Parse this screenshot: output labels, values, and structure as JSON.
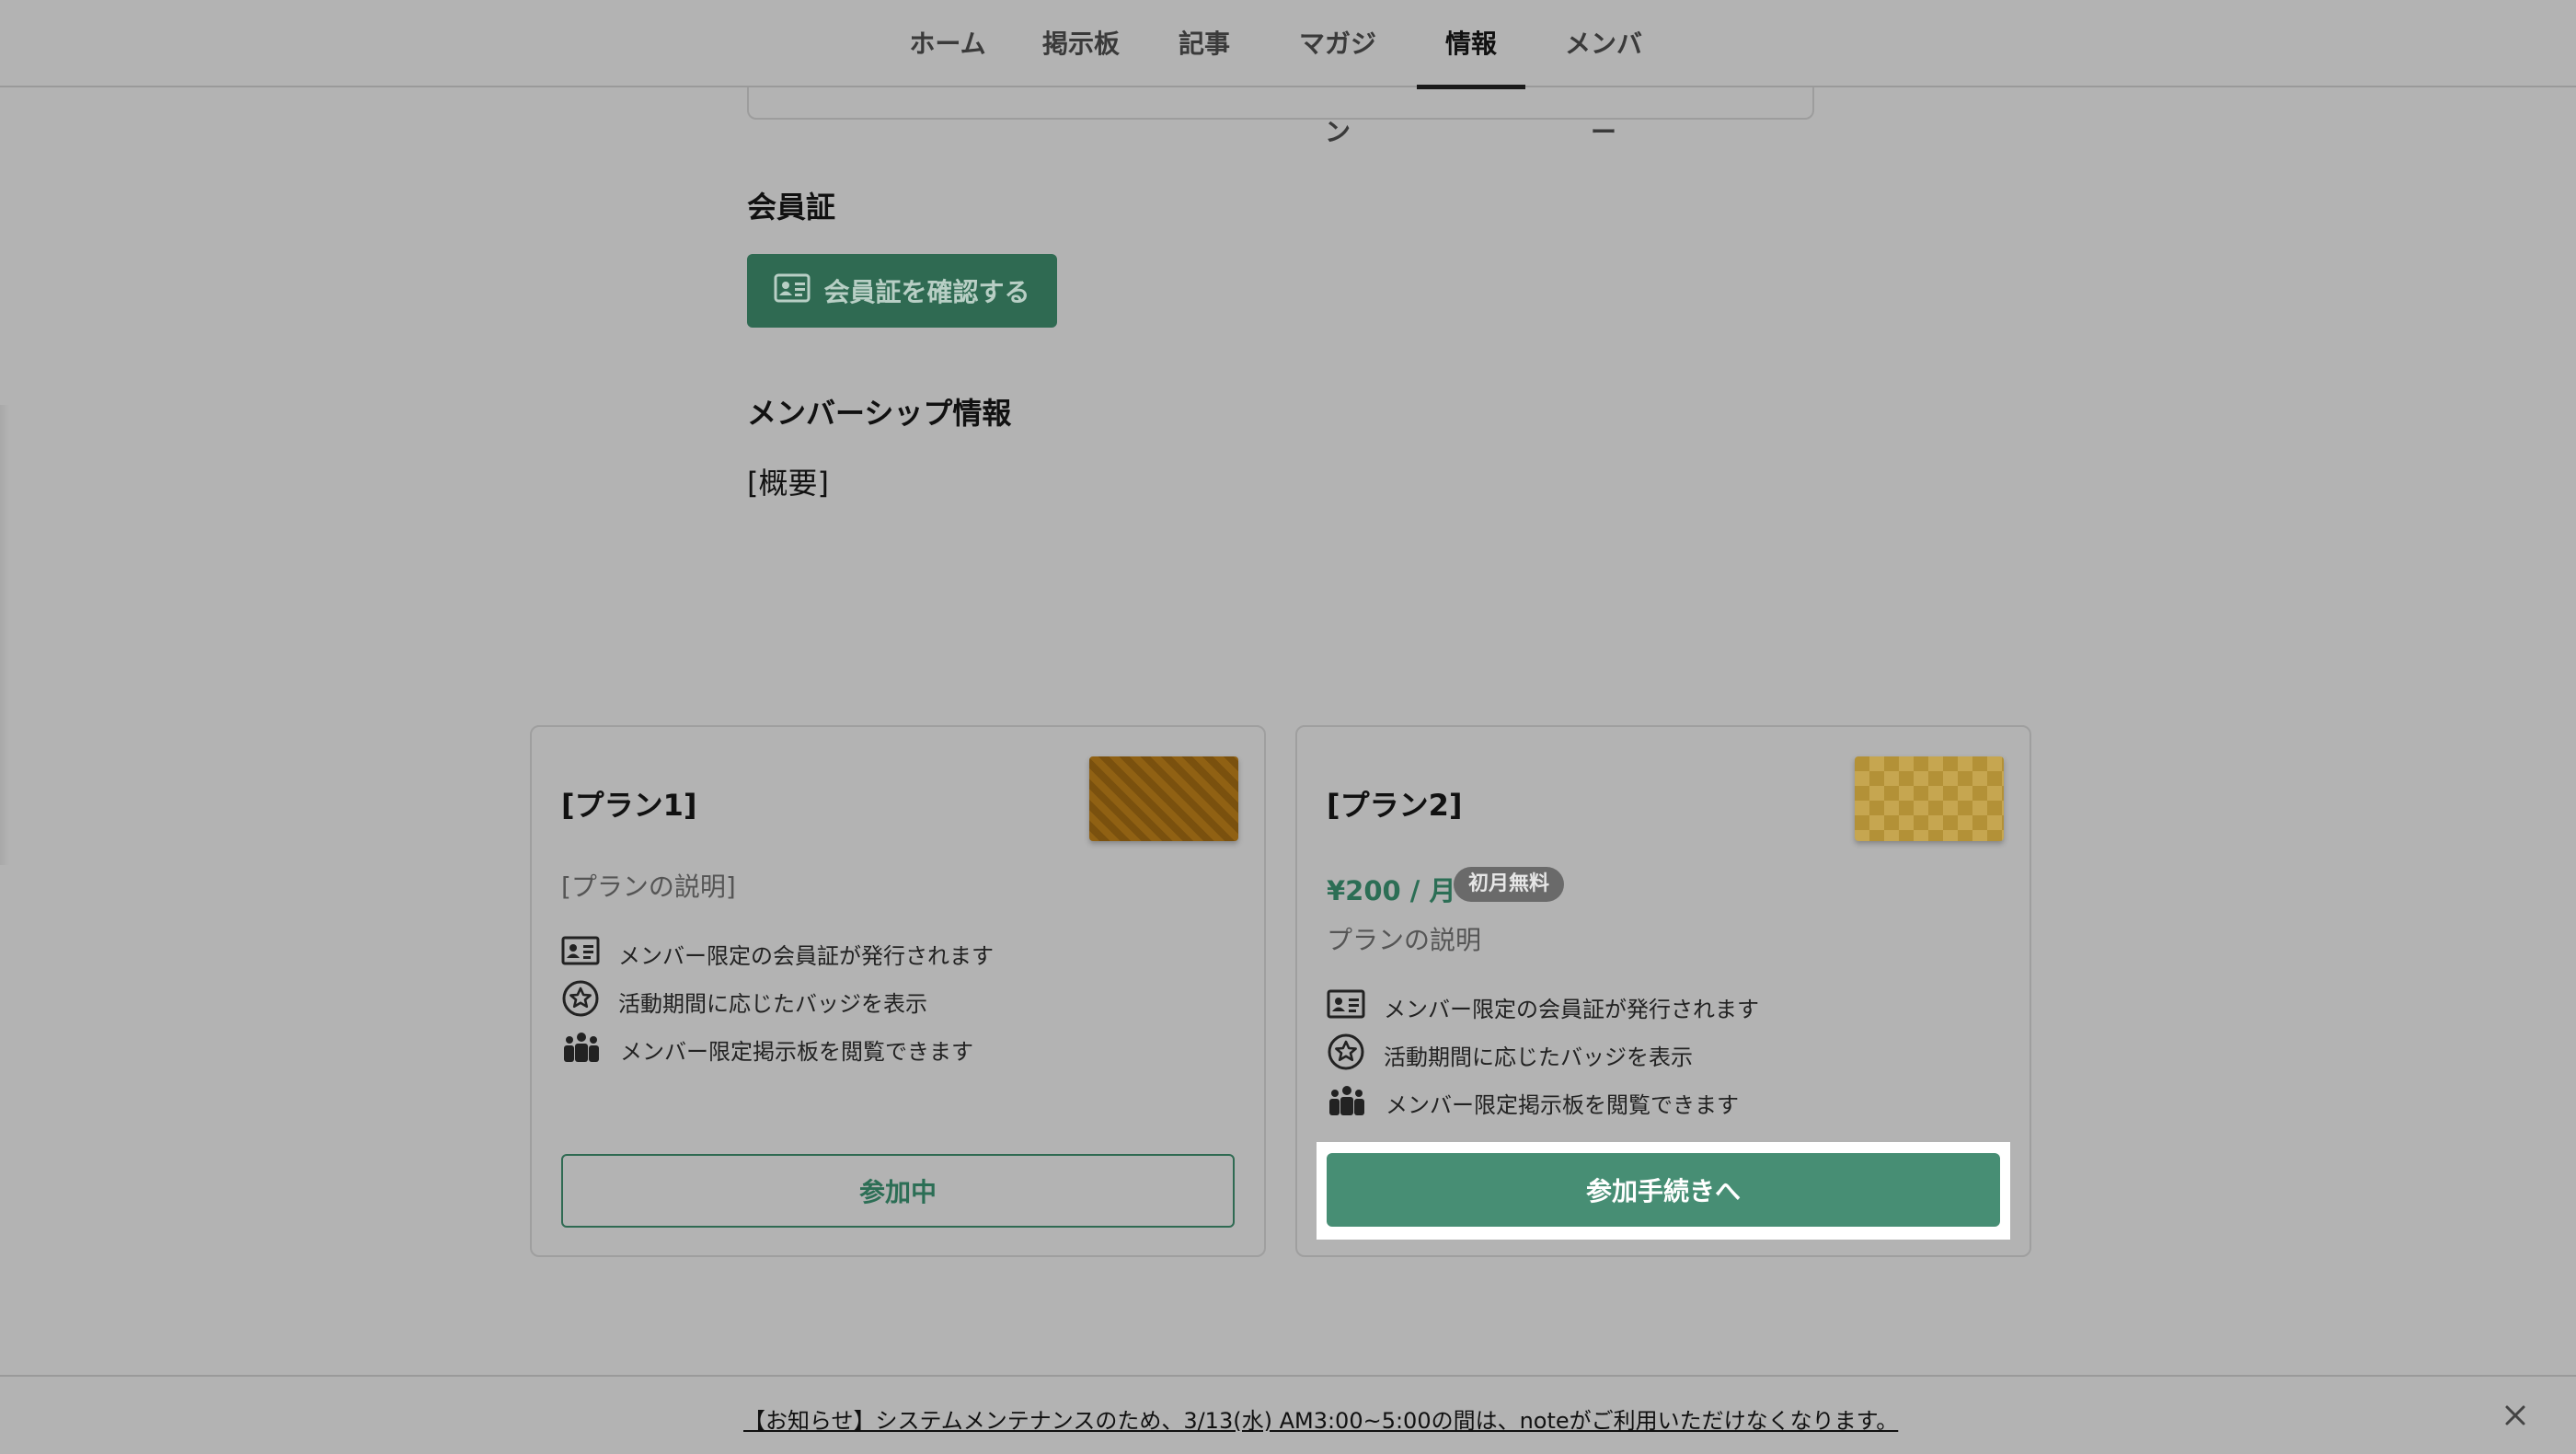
{
  "nav": {
    "tabs": [
      {
        "label": "ホーム",
        "active": false
      },
      {
        "label": "掲示板",
        "active": false
      },
      {
        "label": "記事",
        "active": false
      },
      {
        "label": "マガジン",
        "active": false
      },
      {
        "label": "情報",
        "active": true
      },
      {
        "label": "メンバー",
        "active": false
      }
    ]
  },
  "membership_card": {
    "heading": "会員証",
    "button_label": "会員証を確認する",
    "button_icon": "id-card-icon"
  },
  "membership_info": {
    "heading": "メンバーシップ情報",
    "overview": "[概要]"
  },
  "plans": [
    {
      "title": "[プラン1]",
      "description": "[プランの説明]",
      "features": [
        {
          "icon": "id-card-icon",
          "text": "メンバー限定の会員証が発行されます"
        },
        {
          "icon": "badge-star-icon",
          "text": "活動期間に応じたバッジを表示"
        },
        {
          "icon": "group-icon",
          "text": "メンバー限定掲示板を閲覧できます"
        }
      ],
      "button_label": "参加中"
    },
    {
      "title": "[プラン2]",
      "price": "¥200 / 月",
      "price_badge": "初月無料",
      "description": "プランの説明",
      "features": [
        {
          "icon": "id-card-icon",
          "text": "メンバー限定の会員証が発行されます"
        },
        {
          "icon": "badge-star-icon",
          "text": "活動期間に応じたバッジを表示"
        },
        {
          "icon": "group-icon",
          "text": "メンバー限定掲示板を閲覧できます"
        }
      ],
      "button_label": "参加手続きへ"
    }
  ],
  "notice": {
    "text": "【お知らせ】システムメンテナンスのため、3/13(水) AM3:00~5:00の間は、noteがご利用いただけなくなります。",
    "close_icon": "close-icon"
  },
  "colors": {
    "accent": "#2f6a52",
    "accent_light": "#478e74",
    "overlay_bg": "#b3b3b3"
  }
}
